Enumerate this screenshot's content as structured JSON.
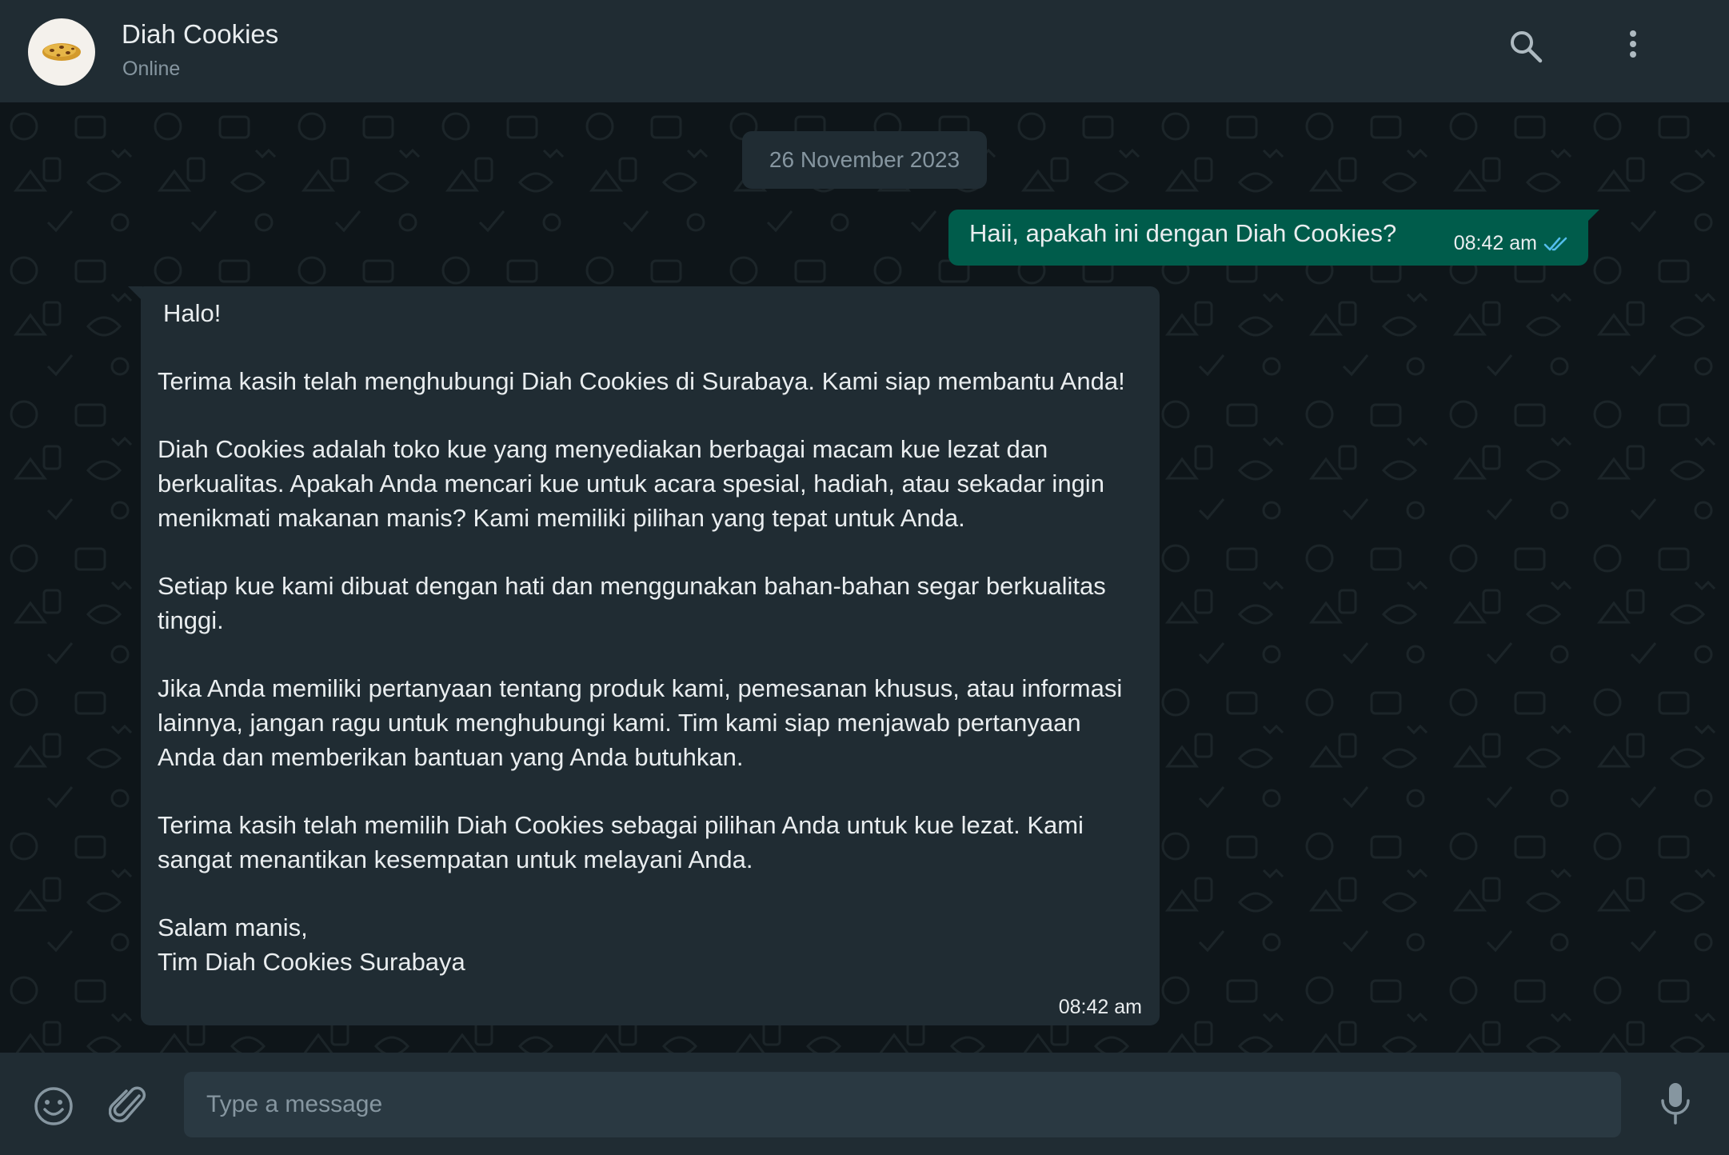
{
  "header": {
    "contact_name": "Diah Cookies",
    "status": "Online",
    "avatar_icon": "cookie-avatar",
    "search_icon": "search-icon",
    "menu_icon": "kebab-menu-icon"
  },
  "chat": {
    "date_divider": "26 November 2023",
    "messages": [
      {
        "direction": "outgoing",
        "text": "Haii, apakah ini dengan Diah Cookies?",
        "time": "08:42 am",
        "status_icon": "double-check-read-icon"
      },
      {
        "direction": "incoming",
        "paragraphs": [
          "Halo!",
          "Terima kasih telah menghubungi Diah Cookies di Surabaya. Kami siap membantu Anda!",
          "Diah Cookies adalah toko kue yang menyediakan berbagai macam kue lezat dan berkualitas. Apakah Anda mencari kue untuk acara spesial, hadiah, atau sekadar ingin menikmati makanan manis? Kami memiliki pilihan yang tepat untuk Anda.",
          "Setiap kue kami dibuat dengan hati dan menggunakan bahan-bahan segar berkualitas tinggi.",
          "Jika Anda memiliki pertanyaan tentang produk kami, pemesanan khusus, atau informasi lainnya, jangan ragu untuk menghubungi kami. Tim kami siap menjawab pertanyaan Anda dan memberikan bantuan yang Anda butuhkan.",
          "Terima kasih telah memilih Diah Cookies sebagai pilihan Anda untuk kue lezat. Kami sangat menantikan kesempatan untuk melayani Anda.",
          "Salam manis,",
          "Tim Diah Cookies Surabaya"
        ],
        "time": "08:42 am"
      }
    ]
  },
  "composer": {
    "placeholder": "Type a message",
    "value": "",
    "emoji_icon": "emoji-icon",
    "attach_icon": "paperclip-icon",
    "mic_icon": "microphone-icon"
  },
  "colors": {
    "header_bg": "#202c33",
    "chat_bg": "#0e1519",
    "outgoing_bubble": "#005c4b",
    "incoming_bubble": "#202c33",
    "read_tick": "#53bdeb",
    "muted_text": "#8696a0"
  }
}
